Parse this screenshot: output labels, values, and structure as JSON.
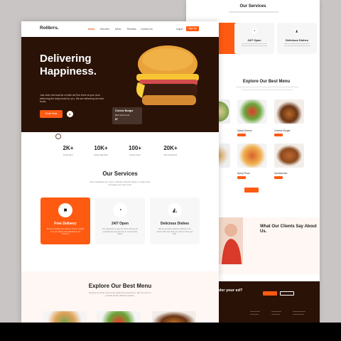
{
  "colors": {
    "accent": "#ff5a12",
    "dark": "#2a1207"
  },
  "back_page": {
    "services_title": "Our Services",
    "cards": [
      {
        "title": "24/7 Open",
        "icon": "clock-icon"
      },
      {
        "title": "Delicious Dishes",
        "icon": "pizza-icon"
      }
    ],
    "menu_title": "Explore Our Best Menu",
    "foods": [
      {
        "name": "Salad Greens"
      },
      {
        "name": "Cheese Burger"
      },
      {
        "name": "Spicy Pizza"
      },
      {
        "name": "Sandwiches"
      }
    ],
    "clients_title": "What Our Clients Say About Us.",
    "footer_heading": "der your ed?"
  },
  "front_page": {
    "logo": "Rollbrrs.",
    "nav": [
      "Home",
      "Services",
      "Menu",
      "Reviews",
      "Contact Us"
    ],
    "login": "Log In",
    "signup": "Sign Up",
    "hero": {
      "title": "Delivering Happiness.",
      "description": "Just order and wait for a while we'll be there at your door delivering the tasty foods for you. We are delivering the best foods.",
      "order_button": "Order Now",
      "burger_card": {
        "title": "Cheese Burger",
        "subtitle": "Best Fast Food",
        "price": "$7"
      }
    },
    "stats": [
      {
        "value": "2K+",
        "label": "Food Item"
      },
      {
        "value": "10K+",
        "label": "Active Member"
      },
      {
        "value": "100+",
        "label": "Active Chef"
      },
      {
        "value": "20K+",
        "label": "Our Customer"
      }
    ],
    "services_title": "Our Services",
    "services_desc": "We've Satisfied our Users. Whether Needs? Easy to create their message your team time.",
    "services": [
      {
        "title": "Free Delivery",
        "icon": "truck-icon",
        "desc": "We are providing free delivery service. Delight us to our clients and dedicated to our business."
      },
      {
        "title": "24/7 Open",
        "icon": "clock-icon",
        "desc": "Our restaurant is open 24 hours and we are providing the best services to our favourite clients."
      },
      {
        "title": "Delicious Dishes",
        "icon": "pizza-icon",
        "desc": "We are providing delicious dishes to our clients. Best food that you will love. Buy your dish."
      }
    ],
    "menu_title": "Explore Our Best Menu",
    "menu_desc": "Explore our best menu and create the experience. We are here to provide all the delicious dishes."
  }
}
